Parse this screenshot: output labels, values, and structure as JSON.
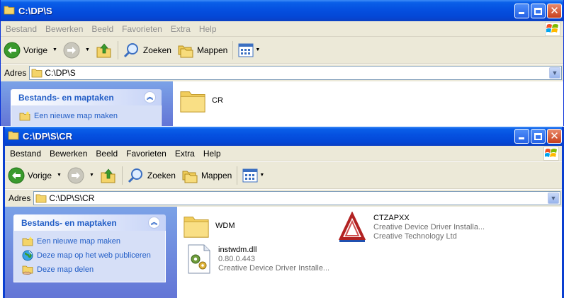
{
  "window1": {
    "title": "C:\\DP\\S",
    "menu": [
      "Bestand",
      "Bewerken",
      "Beeld",
      "Favorieten",
      "Extra",
      "Help"
    ],
    "toolbar": {
      "back": "Vorige",
      "search": "Zoeken",
      "folders": "Mappen"
    },
    "address": {
      "label": "Adres",
      "value": "C:\\DP\\S"
    },
    "tasks": {
      "header": "Bestands- en maptaken",
      "items": [
        "Een nieuwe map maken"
      ]
    },
    "files": [
      {
        "name": "CR",
        "type": "folder"
      }
    ]
  },
  "window2": {
    "title": "C:\\DP\\S\\CR",
    "menu": [
      "Bestand",
      "Bewerken",
      "Beeld",
      "Favorieten",
      "Extra",
      "Help"
    ],
    "toolbar": {
      "back": "Vorige",
      "search": "Zoeken",
      "folders": "Mappen"
    },
    "address": {
      "label": "Adres",
      "value": "C:\\DP\\S\\CR"
    },
    "tasks": {
      "header": "Bestands- en maptaken",
      "items": [
        "Een nieuwe map maken",
        "Deze map op het web publiceren",
        "Deze map delen"
      ]
    },
    "files": [
      {
        "name": "WDM",
        "type": "folder"
      },
      {
        "name": "CTZAPXX",
        "line2": "Creative Device Driver Installa...",
        "line3": "Creative Technology Ltd",
        "type": "driver"
      },
      {
        "name": "instwdm.dll",
        "line2": "0.80.0.443",
        "line3": "Creative Device Driver Installe...",
        "type": "dll"
      }
    ]
  },
  "colors": {
    "titlebar": "#0550e0",
    "taskpane": "#7ba2e7",
    "tasklink": "#215dc6",
    "chrome": "#ece9d8"
  }
}
